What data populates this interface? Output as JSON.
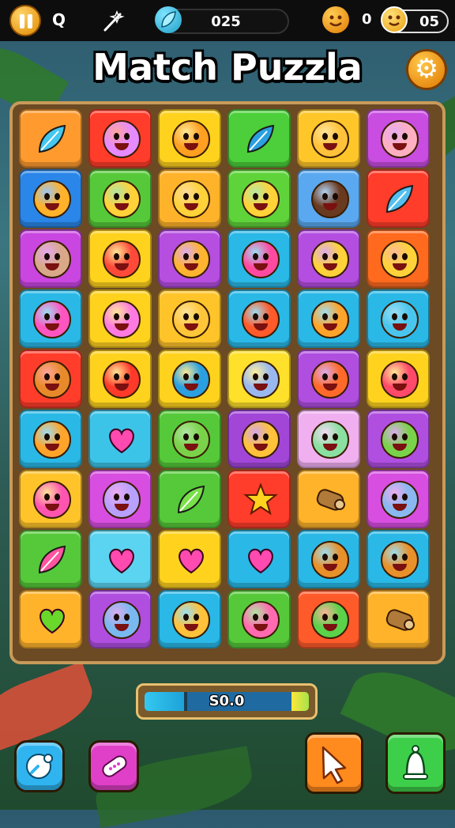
{
  "topbar": {
    "search_glyph": "Q",
    "score_value": "025",
    "coins_value": "0",
    "lives_value": "05",
    "icons": [
      "pause-icon",
      "search-icon",
      "wand-icon",
      "leaf-gem-icon",
      "smiley-coin-icon",
      "lives-face-icon"
    ]
  },
  "title": "Match Puzzla",
  "progress": {
    "text": "S0.0",
    "fill": 0.24,
    "colors": {
      "fill": "#34c8f0",
      "mid": "#1f6aa0",
      "end": "#ffe63a"
    }
  },
  "bottom_buttons": [
    {
      "name": "boost-bubble-button",
      "icon": "bubble-icon",
      "color": "#2fb4f0"
    },
    {
      "name": "boost-bandage-button",
      "icon": "bandage-icon",
      "color": "#e040c8"
    },
    {
      "name": "boost-pointer-button",
      "icon": "pointer-arrow-icon",
      "color": "#ff8a1e"
    },
    {
      "name": "boost-bell-button",
      "icon": "bell-icon",
      "color": "#3ecf4a"
    }
  ],
  "board": {
    "rows": 9,
    "cols": 6,
    "tiles": [
      [
        {
          "bg": "#ff9b2e",
          "item": "leaf",
          "c": "#44c8f0"
        },
        {
          "bg": "#ff3d2a",
          "item": "face",
          "c": "#e68aff"
        },
        {
          "bg": "#ffd21e",
          "item": "face",
          "c": "#ffa020"
        },
        {
          "bg": "#4ccf3a",
          "item": "leaf",
          "c": "#2aa0e0"
        },
        {
          "bg": "#ffc62a",
          "item": "face",
          "c": "#ffc23a"
        },
        {
          "bg": "#c94de0",
          "item": "face",
          "c": "#ffb0c0"
        }
      ],
      [
        {
          "bg": "#2a86e8",
          "item": "face",
          "c": "#ffb22a"
        },
        {
          "bg": "#56c93a",
          "item": "face",
          "c": "#ffd23a"
        },
        {
          "bg": "#ffb32a",
          "item": "face",
          "c": "#ffd23a"
        },
        {
          "bg": "#5fd33a",
          "item": "face",
          "c": "#ffd23a"
        },
        {
          "bg": "#5aa8f0",
          "item": "face",
          "c": "#6a3a20"
        },
        {
          "bg": "#ff3d2a",
          "item": "leaf",
          "c": "#55bff0"
        }
      ],
      [
        {
          "bg": "#c946e0",
          "item": "face",
          "c": "#d8a888"
        },
        {
          "bg": "#ffd21e",
          "item": "face",
          "c": "#ff4a3a"
        },
        {
          "bg": "#b64ee0",
          "item": "face",
          "c": "#ffb430"
        },
        {
          "bg": "#2ab8e6",
          "item": "face",
          "c": "#ff4aa0"
        },
        {
          "bg": "#b44ee0",
          "item": "face",
          "c": "#ffd23a"
        },
        {
          "bg": "#ff6a1e",
          "item": "face",
          "c": "#ffd23a"
        }
      ],
      [
        {
          "bg": "#2ab8e6",
          "item": "face",
          "c": "#ff55c0"
        },
        {
          "bg": "#ffd21e",
          "item": "face",
          "c": "#ff7ae0"
        },
        {
          "bg": "#ffc42a",
          "item": "face",
          "c": "#ffc63a"
        },
        {
          "bg": "#2ab8e6",
          "item": "face",
          "c": "#ff5a2a"
        },
        {
          "bg": "#2ab8e6",
          "item": "face",
          "c": "#ffa42a"
        },
        {
          "bg": "#2ab8e6",
          "item": "face",
          "c": "#4ac6ee"
        }
      ],
      [
        {
          "bg": "#ff3d2a",
          "item": "face",
          "c": "#e88a2a"
        },
        {
          "bg": "#ffd21e",
          "item": "face",
          "c": "#ff3a2a"
        },
        {
          "bg": "#ffd21e",
          "item": "face",
          "c": "#2aa0e0"
        },
        {
          "bg": "#ffe02a",
          "item": "face",
          "c": "#9ab8f0"
        },
        {
          "bg": "#b04ee0",
          "item": "face",
          "c": "#ff6a2a"
        },
        {
          "bg": "#ffd21e",
          "item": "face",
          "c": "#ff4a6a"
        }
      ],
      [
        {
          "bg": "#2ab8e6",
          "item": "face",
          "c": "#ffa42a"
        },
        {
          "bg": "#3cc4e8",
          "item": "heart",
          "c": "#ff4ab0"
        },
        {
          "bg": "#56c93a",
          "item": "face",
          "c": "#7ad24a"
        },
        {
          "bg": "#a246d8",
          "item": "face",
          "c": "#ffc23a"
        },
        {
          "bg": "#f0b0f0",
          "item": "face",
          "c": "#8ae0a0"
        },
        {
          "bg": "#b04ee0",
          "item": "face",
          "c": "#7ad24a"
        }
      ],
      [
        {
          "bg": "#ffc42a",
          "item": "face",
          "c": "#ff55b0"
        },
        {
          "bg": "#d84ee0",
          "item": "face",
          "c": "#b8a0ff"
        },
        {
          "bg": "#56c93a",
          "item": "leaf",
          "c": "#7ae04a"
        },
        {
          "bg": "#ff3d2a",
          "item": "star",
          "c": "#ffd21e"
        },
        {
          "bg": "#ffb32a",
          "item": "log",
          "c": "#b07a3a"
        },
        {
          "bg": "#d84ee0",
          "item": "face",
          "c": "#8ab8f0"
        }
      ],
      [
        {
          "bg": "#56c93a",
          "item": "leaf",
          "c": "#ff55a0"
        },
        {
          "bg": "#5ad4f0",
          "item": "heart",
          "c": "#ff4ab0"
        },
        {
          "bg": "#ffd21e",
          "item": "heart",
          "c": "#ff4ab0"
        },
        {
          "bg": "#2ab8e6",
          "item": "heart",
          "c": "#ff4ab0"
        },
        {
          "bg": "#2ab8e6",
          "item": "face",
          "c": "#e8902a"
        },
        {
          "bg": "#2ab8e6",
          "item": "face",
          "c": "#e8902a"
        }
      ],
      [
        {
          "bg": "#ffb32a",
          "item": "heart",
          "c": "#6ad82a"
        },
        {
          "bg": "#b04ee0",
          "item": "face",
          "c": "#7ab8f0"
        },
        {
          "bg": "#2ab8e6",
          "item": "face",
          "c": "#ffc23a"
        },
        {
          "bg": "#56c93a",
          "item": "face",
          "c": "#ff6ab0"
        },
        {
          "bg": "#ff5a2a",
          "item": "face",
          "c": "#5ad24a"
        },
        {
          "bg": "#ffb32a",
          "item": "log",
          "c": "#b07a3a"
        }
      ]
    ]
  }
}
